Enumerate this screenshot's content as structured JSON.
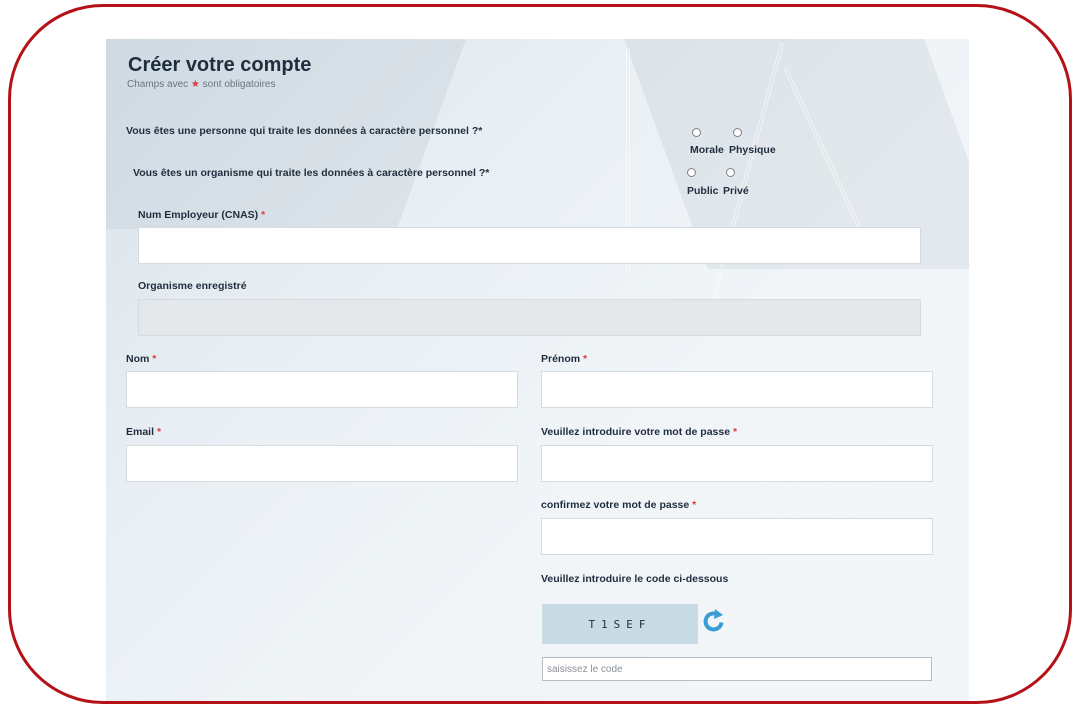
{
  "form": {
    "title": "Créer votre compte",
    "subtitle_prefix": "Champs avec",
    "subtitle_star": "★",
    "subtitle_suffix": "sont obligatoires"
  },
  "questions": {
    "personne": {
      "text": "Vous êtes une personne qui traite les données à caractère personnel ?*",
      "options": [
        "Morale",
        "Physique"
      ]
    },
    "organisme": {
      "text": "Vous êtes un organisme qui traite les données à caractère personnel ?*",
      "options": [
        "Public",
        "Privé"
      ]
    }
  },
  "fields": {
    "num_employeur": {
      "label": "Num Employeur (CNAS)",
      "value": ""
    },
    "organisme_enregistre": {
      "label": "Organisme enregistré",
      "value": ""
    },
    "nom": {
      "label": "Nom",
      "value": ""
    },
    "prenom": {
      "label": "Prénom",
      "value": ""
    },
    "email": {
      "label": "Email",
      "value": ""
    },
    "password": {
      "label": "Veuillez introduire votre mot de passe",
      "value": ""
    },
    "confirm_password": {
      "label": "confirmez votre mot de passe",
      "value": ""
    },
    "code": {
      "label": "Veuillez introduire le code ci-dessous",
      "placeholder": "saisissez le code",
      "value": ""
    }
  },
  "captcha": {
    "text": "T1SEF"
  },
  "required_marker": "*",
  "colors": {
    "frame_border": "#b51218",
    "required_star": "#e03a3a",
    "captcha_bg": "#c9dce6",
    "refresh_icon": "#3a9bd5",
    "title_text": "#1f2d3d"
  },
  "icons": {
    "refresh": "refresh-icon"
  }
}
